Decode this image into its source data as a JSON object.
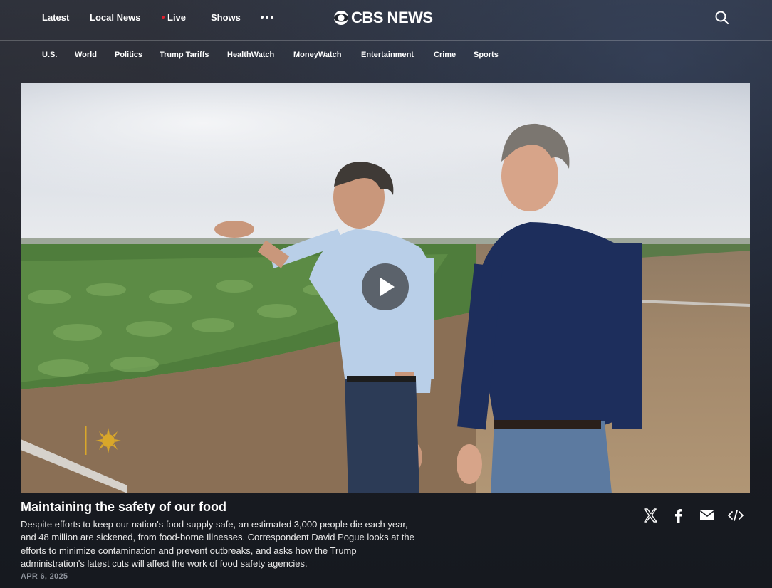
{
  "topnav": {
    "latest": "Latest",
    "local_news": "Local News",
    "live": "Live",
    "shows": "Shows",
    "more_icon": "more-dots-icon",
    "logo_text": "CBS NEWS",
    "search_icon": "search-icon"
  },
  "subnav": {
    "items": [
      "U.S.",
      "World",
      "Politics",
      "Trump Tariffs",
      "HealthWatch",
      "MoneyWatch",
      "Entertainment",
      "Crime",
      "Sports"
    ]
  },
  "video": {
    "play_icon": "play-icon",
    "watermark": "sunburst-logo"
  },
  "article": {
    "title": "Maintaining the safety of our food",
    "description": "Despite efforts to keep our nation's food supply safe, an estimated 3,000 people die each year, and 48 million are sickened, from food-borne Illnesses. Correspondent David Pogue looks at the efforts to minimize contamination and prevent outbreaks, and asks how the Trump administration's latest cuts will affect the work of food safety agencies.",
    "date": "APR 6, 2025"
  },
  "share": {
    "icons": [
      "x-icon",
      "facebook-icon",
      "email-icon",
      "embed-icon"
    ]
  },
  "colors": {
    "live_dot": "#e2202e",
    "page_bg": "#14171c",
    "date_text": "#8d929b"
  }
}
